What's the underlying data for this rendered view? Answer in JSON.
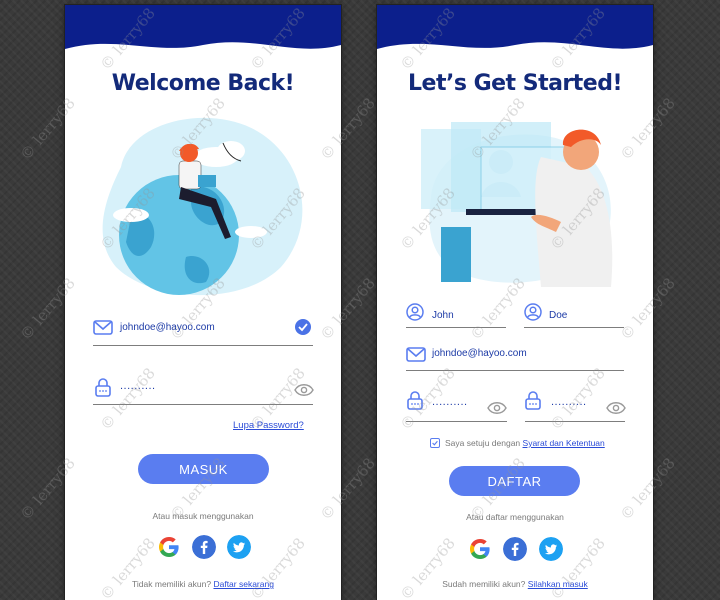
{
  "login": {
    "title": "Welcome Back!",
    "email_value": "johndoe@hayoo.com",
    "password_masked": "..........",
    "forgot_link": "Lupa Password?",
    "submit_label": "MASUK",
    "social_caption": "Atau masuk menggunakan",
    "footer_text": "Tidak memiliki akun?",
    "footer_link": "Daftar sekarang"
  },
  "register": {
    "title": "Let’s Get Started!",
    "first_name": "John",
    "last_name": "Doe",
    "email_value": "johndoe@hayoo.com",
    "password_masked": "..........",
    "confirm_masked": "..........",
    "agree_text": "Saya setuju dengan",
    "agree_link": "Syarat dan Ketentuan",
    "agree_checked": true,
    "submit_label": "DAFTAR",
    "social_caption": "Atau daftar menggunakan",
    "footer_text": "Sudah memiliki akun?",
    "footer_link": "Silahkan masuk"
  },
  "social": [
    "google-icon",
    "facebook-icon",
    "twitter-icon"
  ],
  "colors": {
    "header": "#0c1f8c",
    "title": "#132a7a",
    "accent": "#5a7df0",
    "link": "#2a4bd7",
    "facebook": "#3b6fd6",
    "twitter": "#1da1f2"
  },
  "watermark": "© lerry68"
}
